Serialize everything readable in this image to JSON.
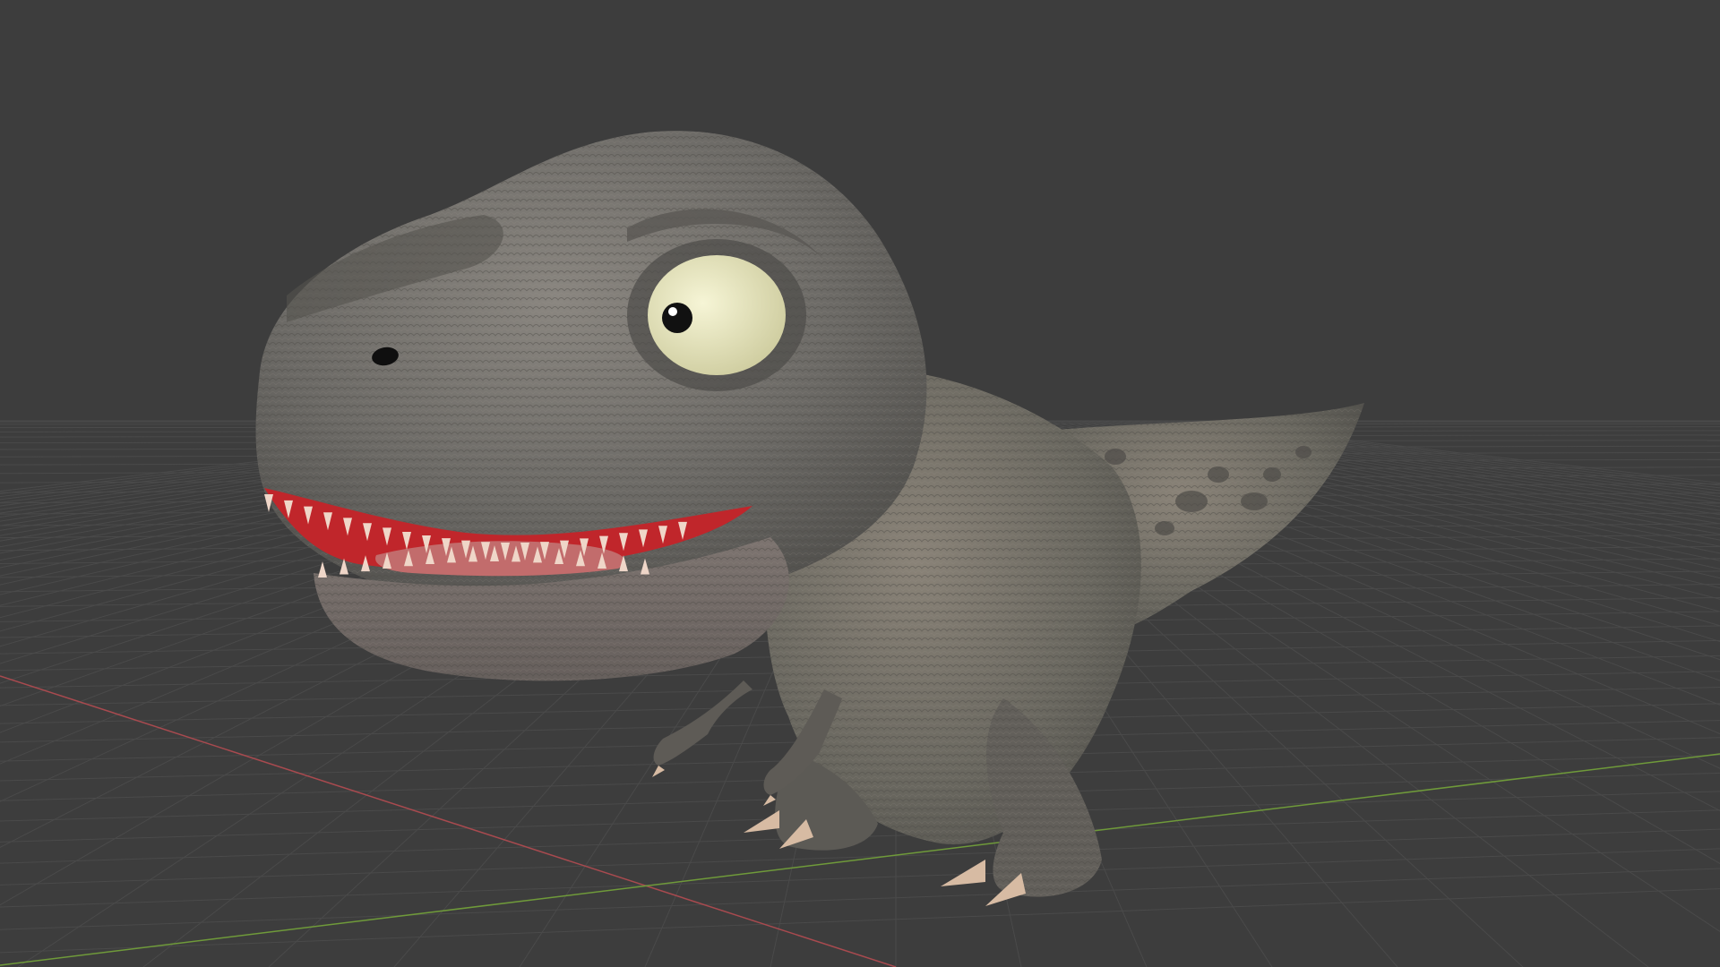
{
  "viewport": {
    "background_color": "#3d3d3d",
    "grid_line_color": "#4a4a4a",
    "x_axis_color": "#a84a4f",
    "y_axis_color": "#6f9a3a"
  },
  "model": {
    "skin_color": "#6c6a66",
    "skin_shadow_color": "#4f4e4b",
    "skin_highlight_color": "#87837d",
    "spot_color": "#4e4c48",
    "eye_color": "#ecebc2",
    "pupil_color": "#111111",
    "mouth_color": "#c0262b",
    "tongue_color": "#c26c6c",
    "teeth_color": "#efd6c8",
    "claw_color": "#d7bba3"
  }
}
